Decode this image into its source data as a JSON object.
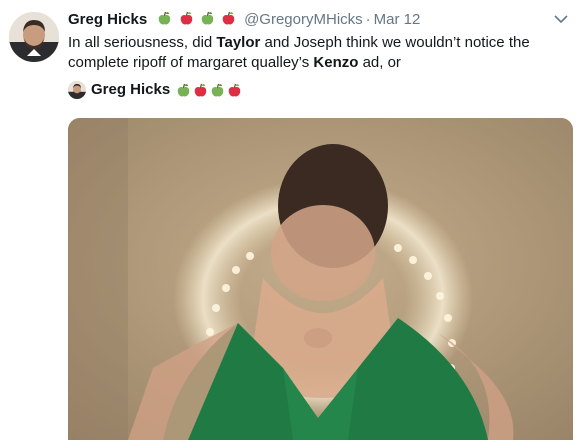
{
  "tweet": {
    "author_name": "Greg Hicks",
    "handle": "@GregoryMHicks",
    "separator": "·",
    "date": "Mar 12",
    "text_parts": [
      "In all seriousness, did ",
      "Taylor",
      " and Joseph think we wouldn’t notice the complete ripoff of margaret qualley’s ",
      "Kenzo",
      " ad, or"
    ],
    "emojis": [
      "green-apple-icon",
      "red-apple-icon",
      "green-apple-icon",
      "red-apple-icon"
    ]
  },
  "quoted": {
    "author_name": "Greg Hicks",
    "emojis": [
      "green-apple-icon",
      "red-apple-icon",
      "green-apple-icon",
      "red-apple-icon"
    ]
  },
  "colors": {
    "text": "#14171a",
    "secondary": "#657786",
    "green_apple": "#77b255",
    "red_apple": "#dd2e44",
    "dress": "#1f7a43"
  }
}
